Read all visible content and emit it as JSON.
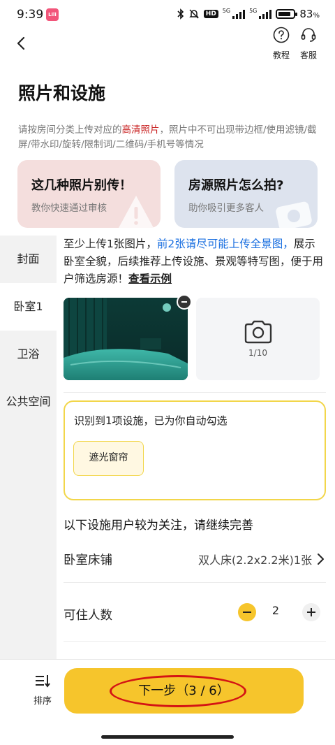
{
  "status_bar": {
    "time": "9:39",
    "app_badge": "Lili",
    "hd_label": "HD",
    "net_1": "5G",
    "net_2": "5G",
    "battery_level": 0.83,
    "battery_pct": "83",
    "battery_unit": "%"
  },
  "nav": {
    "tutorial_label": "教程",
    "service_label": "客服"
  },
  "page": {
    "title": "照片和设施",
    "notice_part1": "请按房间分类上传对应的",
    "notice_highlight": "高清照片",
    "notice_part2": "，照片中不可出现带边框/使用滤镜/截屏/带水印/旋转/限制词/二维码/手机号等情况"
  },
  "cards": [
    {
      "title": "这几种照片别传！",
      "subtitle": "教你快速通过审核"
    },
    {
      "title": "房源照片怎么拍?",
      "subtitle": "助你吸引更多客人"
    }
  ],
  "tabs": [
    {
      "label": "封面"
    },
    {
      "label": "卧室1"
    },
    {
      "label": "卫浴"
    },
    {
      "label": "公共空间"
    }
  ],
  "active_tab": "卧室1",
  "content": {
    "intro_part1": "至少上传1张图片，",
    "intro_blue": "前2张请尽可能上传全景图，",
    "intro_part2": "展示卧室全貌，后续推荐上传设施、景观等特写图，便于用户筛选房源！",
    "intro_link": "查看示例",
    "upload_count": "1/10",
    "detect_text": "识别到1项设施，已为你自动勾选",
    "detected_chip": "遮光窗帘",
    "section_title": "以下设施用户较为关注，请继续完善",
    "bed_label": "卧室床铺",
    "bed_value": "双人床(2.2x2.2米)1张",
    "guests_label": "可住人数",
    "guests_value": "2"
  },
  "bottom": {
    "sort_label": "排序",
    "next_label": "下一步（3 / 6）"
  },
  "colors": {
    "accent_yellow": "#f6c52c",
    "highlight_red": "#c81e1e",
    "link_blue": "#1a6fe0",
    "annotation_red": "#d41414"
  },
  "icons": [
    "back-arrow-icon",
    "help-icon",
    "headset-icon",
    "warning-icon",
    "camera-icon",
    "minus-icon",
    "plus-icon",
    "chevron-right-icon",
    "sort-icon"
  ]
}
